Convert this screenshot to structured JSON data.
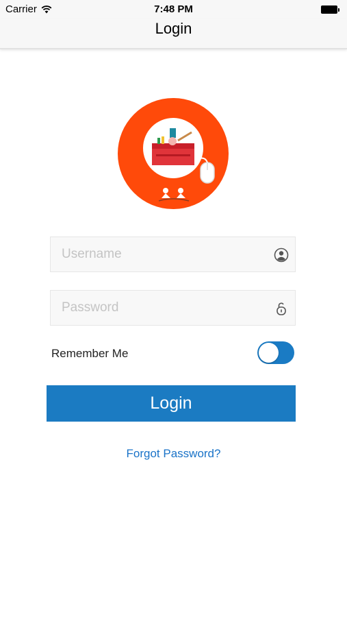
{
  "status_bar": {
    "carrier": "Carrier",
    "time": "7:48 PM"
  },
  "nav": {
    "title": "Login"
  },
  "form": {
    "username": {
      "placeholder": "Username",
      "value": ""
    },
    "password": {
      "placeholder": "Password",
      "value": ""
    },
    "remember_label": "Remember Me",
    "remember_on": true,
    "login_label": "Login",
    "forgot_label": "Forgot Password?"
  },
  "icons": {
    "username": "user-circle-icon",
    "password": "unlock-icon",
    "wifi": "wifi-icon",
    "battery": "battery-icon"
  },
  "colors": {
    "accent": "#1b7bc2",
    "logo_ring": "#ff4a0a",
    "link": "#1a73c8"
  }
}
